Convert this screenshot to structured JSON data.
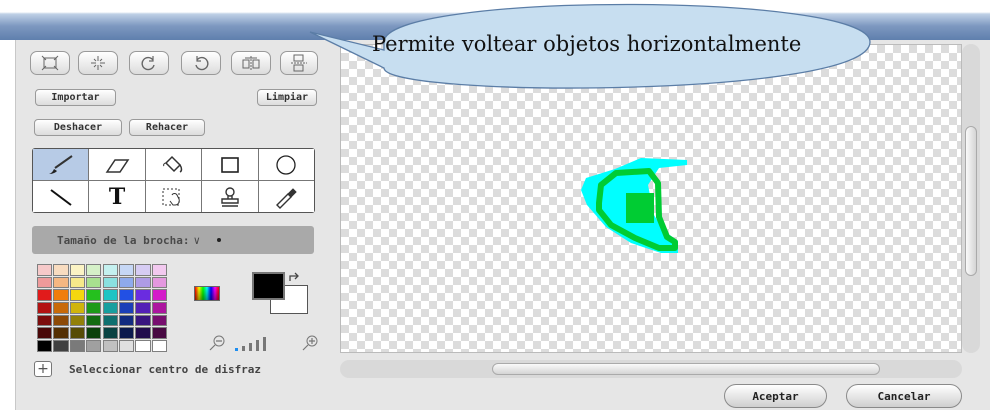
{
  "callout": {
    "text": "Permite voltear objetos horizontalmente"
  },
  "toolbar": {
    "buttons": [
      "grow-icon",
      "shrink-icon",
      "rotate-left-icon",
      "rotate-right-icon",
      "flip-horizontal-icon",
      "flip-vertical-icon"
    ]
  },
  "actions": {
    "import_label": "Importar",
    "clear_label": "Limpiar",
    "undo_label": "Deshacer",
    "redo_label": "Rehacer"
  },
  "tools": [
    {
      "icon": "paintbrush-icon",
      "selected": true
    },
    {
      "icon": "eraser-icon"
    },
    {
      "icon": "fill-bucket-icon"
    },
    {
      "icon": "rectangle-icon"
    },
    {
      "icon": "ellipse-icon"
    },
    {
      "icon": "line-icon"
    },
    {
      "icon": "text-icon",
      "glyph": "T"
    },
    {
      "icon": "select-icon"
    },
    {
      "icon": "stamp-icon"
    },
    {
      "icon": "eyedropper-icon"
    }
  ],
  "brush": {
    "label": "Tamaño de la brocha:",
    "caret": "∨"
  },
  "palette": {
    "colors": [
      "#f6c9c9",
      "#f8dcc0",
      "#fbf3c4",
      "#d5f0c8",
      "#c4f0ef",
      "#c6d7f5",
      "#d6ccf3",
      "#f2c9ef",
      "#ee9a9a",
      "#f5b782",
      "#f7e98a",
      "#a8e08f",
      "#8ae1e0",
      "#8eaaec",
      "#ae9be6",
      "#e498df",
      "#e11b1b",
      "#f07d0c",
      "#f5d70e",
      "#25c01e",
      "#1ec4c4",
      "#2250e4",
      "#6a2ce0",
      "#d41cc9",
      "#b31212",
      "#c86a0a",
      "#d0b40c",
      "#1d9a18",
      "#179f9f",
      "#1b3fb8",
      "#5320b6",
      "#ac169f",
      "#7c0c0c",
      "#8d4a07",
      "#928009",
      "#136c11",
      "#0f6f6f",
      "#122b80",
      "#39157f",
      "#780f6f",
      "#4a0707",
      "#553004",
      "#574c05",
      "#0b410a",
      "#094242",
      "#0b1a4d",
      "#220c4c",
      "#480942",
      "#000000",
      "#404040",
      "#7a7a7a",
      "#a0a0a0",
      "#c0c0c0",
      "#e0e0e0",
      "#ffffff",
      "#ffffff"
    ],
    "foreground": "#000000",
    "background": "#ffffff"
  },
  "center_costume": {
    "label": "Seleccionar centro de disfraz"
  },
  "footer": {
    "ok_label": "Aceptar",
    "cancel_label": "Cancelar"
  },
  "sprite_colors": {
    "outer": "#00ffff",
    "inner": "#00cc33"
  }
}
